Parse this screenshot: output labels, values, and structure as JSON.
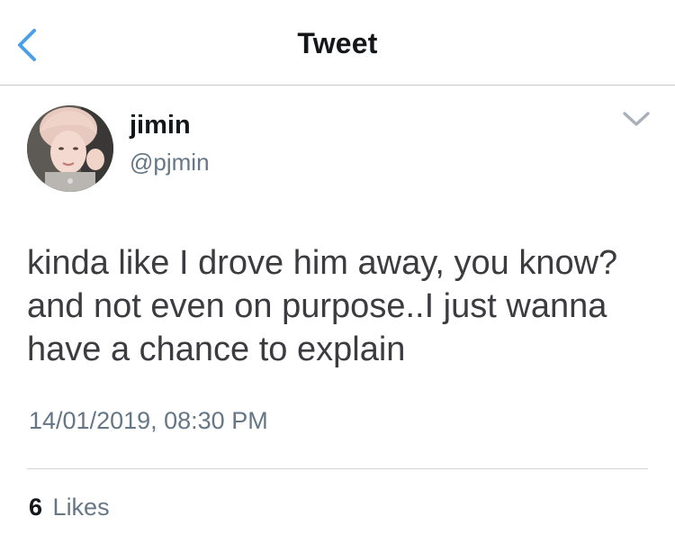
{
  "nav": {
    "title": "Tweet",
    "back_icon": "chevron-left-icon",
    "accent_color": "#4a9fe8"
  },
  "tweet": {
    "author": {
      "display_name": "jimin",
      "username": "@pjmin"
    },
    "more_icon": "chevron-down-icon",
    "text": "kinda like I drove him away, you know? and not even on purpose..I just wanna have a chance to explain",
    "timestamp": "14/01/2019, 08:30 PM",
    "stats": {
      "likes_count": "6",
      "likes_label": "Likes"
    }
  }
}
